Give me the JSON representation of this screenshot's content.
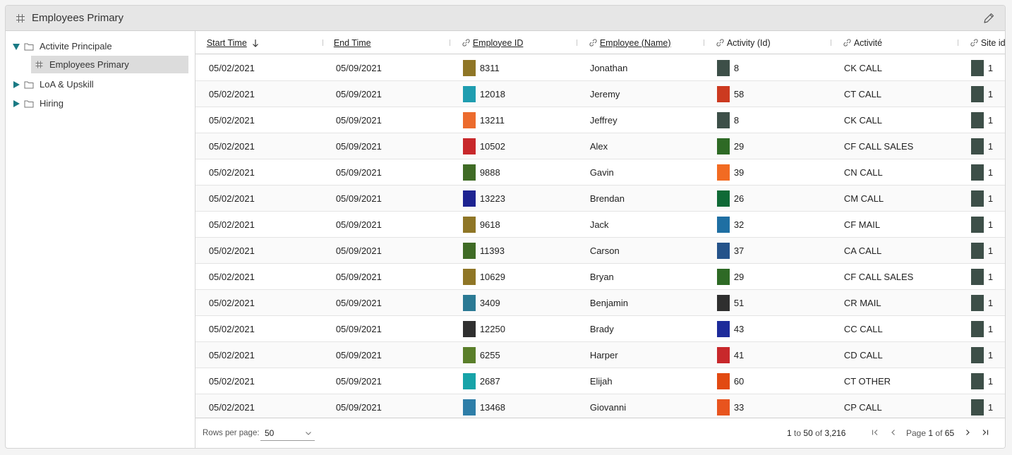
{
  "panel": {
    "title": "Employees Primary"
  },
  "tree": {
    "items": [
      {
        "label": "Activite Principale",
        "expanded": true
      },
      {
        "label": "LoA & Upskill",
        "expanded": false
      },
      {
        "label": "Hiring",
        "expanded": false
      }
    ],
    "child": {
      "label": "Employees Primary",
      "selected": true
    }
  },
  "table": {
    "columns": {
      "start_time": "Start Time",
      "end_time": "End Time",
      "employee_id": "Employee ID",
      "employee_name": "Employee (Name)",
      "activity_id": "Activity (Id)",
      "activite": "Activité",
      "site_id": "Site id"
    },
    "rows": [
      {
        "start": "05/02/2021",
        "end": "05/09/2021",
        "emp_id": "8311",
        "emp_color": "#8f7626",
        "name": "Jonathan",
        "act_id": "8",
        "act_color": "#3d4f48",
        "activite": "CK CALL",
        "site": "1",
        "site_color": "#3d4f48"
      },
      {
        "start": "05/02/2021",
        "end": "05/09/2021",
        "emp_id": "12018",
        "emp_color": "#1f9db0",
        "name": "Jeremy",
        "act_id": "58",
        "act_color": "#cc3a20",
        "activite": "CT CALL",
        "site": "1",
        "site_color": "#3d4f48"
      },
      {
        "start": "05/02/2021",
        "end": "05/09/2021",
        "emp_id": "13211",
        "emp_color": "#ec6b2d",
        "name": "Jeffrey",
        "act_id": "8",
        "act_color": "#3d4f48",
        "activite": "CK CALL",
        "site": "1",
        "site_color": "#3d4f48"
      },
      {
        "start": "05/02/2021",
        "end": "05/09/2021",
        "emp_id": "10502",
        "emp_color": "#c8282b",
        "name": "Alex",
        "act_id": "29",
        "act_color": "#2e6a25",
        "activite": "CF CALL SALES",
        "site": "1",
        "site_color": "#3d4f48"
      },
      {
        "start": "05/02/2021",
        "end": "05/09/2021",
        "emp_id": "9888",
        "emp_color": "#3f6b25",
        "name": "Gavin",
        "act_id": "39",
        "act_color": "#f26b22",
        "activite": "CN CALL",
        "site": "1",
        "site_color": "#3d4f48"
      },
      {
        "start": "05/02/2021",
        "end": "05/09/2021",
        "emp_id": "13223",
        "emp_color": "#1d2391",
        "name": "Brendan",
        "act_id": "26",
        "act_color": "#0f6a36",
        "activite": "CM CALL",
        "site": "1",
        "site_color": "#3d4f48"
      },
      {
        "start": "05/02/2021",
        "end": "05/09/2021",
        "emp_id": "9618",
        "emp_color": "#8f7626",
        "name": "Jack",
        "act_id": "32",
        "act_color": "#1f6fa3",
        "activite": "CF MAIL",
        "site": "1",
        "site_color": "#3d4f48"
      },
      {
        "start": "05/02/2021",
        "end": "05/09/2021",
        "emp_id": "11393",
        "emp_color": "#3f6b25",
        "name": "Carson",
        "act_id": "37",
        "act_color": "#25538a",
        "activite": "CA CALL",
        "site": "1",
        "site_color": "#3d4f48"
      },
      {
        "start": "05/02/2021",
        "end": "05/09/2021",
        "emp_id": "10629",
        "emp_color": "#8f7626",
        "name": "Bryan",
        "act_id": "29",
        "act_color": "#2e6a25",
        "activite": "CF CALL SALES",
        "site": "1",
        "site_color": "#3d4f48"
      },
      {
        "start": "05/02/2021",
        "end": "05/09/2021",
        "emp_id": "3409",
        "emp_color": "#2b7a94",
        "name": "Benjamin",
        "act_id": "51",
        "act_color": "#2f2f2f",
        "activite": "CR MAIL",
        "site": "1",
        "site_color": "#3d4f48"
      },
      {
        "start": "05/02/2021",
        "end": "05/09/2021",
        "emp_id": "12250",
        "emp_color": "#2f2f2f",
        "name": "Brady",
        "act_id": "43",
        "act_color": "#1d2b9a",
        "activite": "CC CALL",
        "site": "1",
        "site_color": "#3d4f48"
      },
      {
        "start": "05/02/2021",
        "end": "05/09/2021",
        "emp_id": "6255",
        "emp_color": "#5a7f2a",
        "name": "Harper",
        "act_id": "41",
        "act_color": "#c8282b",
        "activite": "CD CALL",
        "site": "1",
        "site_color": "#3d4f48"
      },
      {
        "start": "05/02/2021",
        "end": "05/09/2021",
        "emp_id": "2687",
        "emp_color": "#17a3a8",
        "name": "Elijah",
        "act_id": "60",
        "act_color": "#e24a12",
        "activite": "CT OTHER",
        "site": "1",
        "site_color": "#3d4f48"
      },
      {
        "start": "05/02/2021",
        "end": "05/09/2021",
        "emp_id": "13468",
        "emp_color": "#2e7ea8",
        "name": "Giovanni",
        "act_id": "33",
        "act_color": "#e8541e",
        "activite": "CP CALL",
        "site": "1",
        "site_color": "#3d4f48"
      }
    ]
  },
  "footer": {
    "rows_per_page_label": "Rows per page:",
    "rows_per_page_value": "50",
    "range_from": "1",
    "range_to_word": "to",
    "range_to": "50",
    "range_of_word": "of",
    "range_total": "3,216",
    "page_word": "Page",
    "page_current": "1",
    "page_of_word": "of",
    "page_total": "65"
  },
  "colors": {
    "caret": "#1a7a84",
    "selected_bg": "#dcdcdc",
    "titlebar_bg": "#e6e6e6"
  },
  "icons": [
    "grid-icon",
    "edit-pencil-icon",
    "caret-down-icon",
    "caret-right-icon",
    "folder-icon",
    "link-icon",
    "sort-desc-arrow-icon",
    "chevron-down-icon",
    "first-page-icon",
    "prev-page-icon",
    "next-page-icon",
    "last-page-icon"
  ]
}
